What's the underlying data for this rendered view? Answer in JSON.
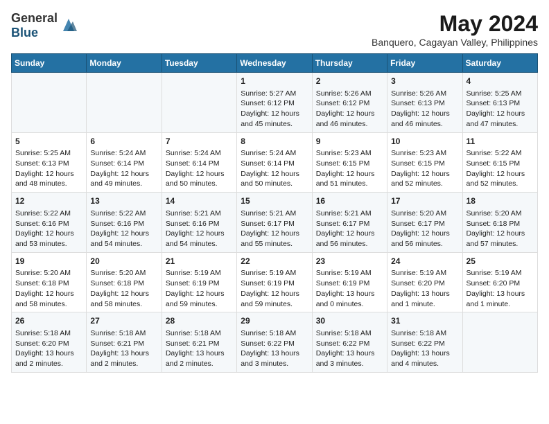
{
  "header": {
    "logo_general": "General",
    "logo_blue": "Blue",
    "month_title": "May 2024",
    "location": "Banquero, Cagayan Valley, Philippines"
  },
  "weekdays": [
    "Sunday",
    "Monday",
    "Tuesday",
    "Wednesday",
    "Thursday",
    "Friday",
    "Saturday"
  ],
  "weeks": [
    [
      {
        "day": "",
        "info": ""
      },
      {
        "day": "",
        "info": ""
      },
      {
        "day": "",
        "info": ""
      },
      {
        "day": "1",
        "info": "Sunrise: 5:27 AM\nSunset: 6:12 PM\nDaylight: 12 hours and 45 minutes."
      },
      {
        "day": "2",
        "info": "Sunrise: 5:26 AM\nSunset: 6:12 PM\nDaylight: 12 hours and 46 minutes."
      },
      {
        "day": "3",
        "info": "Sunrise: 5:26 AM\nSunset: 6:13 PM\nDaylight: 12 hours and 46 minutes."
      },
      {
        "day": "4",
        "info": "Sunrise: 5:25 AM\nSunset: 6:13 PM\nDaylight: 12 hours and 47 minutes."
      }
    ],
    [
      {
        "day": "5",
        "info": "Sunrise: 5:25 AM\nSunset: 6:13 PM\nDaylight: 12 hours and 48 minutes."
      },
      {
        "day": "6",
        "info": "Sunrise: 5:24 AM\nSunset: 6:14 PM\nDaylight: 12 hours and 49 minutes."
      },
      {
        "day": "7",
        "info": "Sunrise: 5:24 AM\nSunset: 6:14 PM\nDaylight: 12 hours and 50 minutes."
      },
      {
        "day": "8",
        "info": "Sunrise: 5:24 AM\nSunset: 6:14 PM\nDaylight: 12 hours and 50 minutes."
      },
      {
        "day": "9",
        "info": "Sunrise: 5:23 AM\nSunset: 6:15 PM\nDaylight: 12 hours and 51 minutes."
      },
      {
        "day": "10",
        "info": "Sunrise: 5:23 AM\nSunset: 6:15 PM\nDaylight: 12 hours and 52 minutes."
      },
      {
        "day": "11",
        "info": "Sunrise: 5:22 AM\nSunset: 6:15 PM\nDaylight: 12 hours and 52 minutes."
      }
    ],
    [
      {
        "day": "12",
        "info": "Sunrise: 5:22 AM\nSunset: 6:16 PM\nDaylight: 12 hours and 53 minutes."
      },
      {
        "day": "13",
        "info": "Sunrise: 5:22 AM\nSunset: 6:16 PM\nDaylight: 12 hours and 54 minutes."
      },
      {
        "day": "14",
        "info": "Sunrise: 5:21 AM\nSunset: 6:16 PM\nDaylight: 12 hours and 54 minutes."
      },
      {
        "day": "15",
        "info": "Sunrise: 5:21 AM\nSunset: 6:17 PM\nDaylight: 12 hours and 55 minutes."
      },
      {
        "day": "16",
        "info": "Sunrise: 5:21 AM\nSunset: 6:17 PM\nDaylight: 12 hours and 56 minutes."
      },
      {
        "day": "17",
        "info": "Sunrise: 5:20 AM\nSunset: 6:17 PM\nDaylight: 12 hours and 56 minutes."
      },
      {
        "day": "18",
        "info": "Sunrise: 5:20 AM\nSunset: 6:18 PM\nDaylight: 12 hours and 57 minutes."
      }
    ],
    [
      {
        "day": "19",
        "info": "Sunrise: 5:20 AM\nSunset: 6:18 PM\nDaylight: 12 hours and 58 minutes."
      },
      {
        "day": "20",
        "info": "Sunrise: 5:20 AM\nSunset: 6:18 PM\nDaylight: 12 hours and 58 minutes."
      },
      {
        "day": "21",
        "info": "Sunrise: 5:19 AM\nSunset: 6:19 PM\nDaylight: 12 hours and 59 minutes."
      },
      {
        "day": "22",
        "info": "Sunrise: 5:19 AM\nSunset: 6:19 PM\nDaylight: 12 hours and 59 minutes."
      },
      {
        "day": "23",
        "info": "Sunrise: 5:19 AM\nSunset: 6:19 PM\nDaylight: 13 hours and 0 minutes."
      },
      {
        "day": "24",
        "info": "Sunrise: 5:19 AM\nSunset: 6:20 PM\nDaylight: 13 hours and 1 minute."
      },
      {
        "day": "25",
        "info": "Sunrise: 5:19 AM\nSunset: 6:20 PM\nDaylight: 13 hours and 1 minute."
      }
    ],
    [
      {
        "day": "26",
        "info": "Sunrise: 5:18 AM\nSunset: 6:20 PM\nDaylight: 13 hours and 2 minutes."
      },
      {
        "day": "27",
        "info": "Sunrise: 5:18 AM\nSunset: 6:21 PM\nDaylight: 13 hours and 2 minutes."
      },
      {
        "day": "28",
        "info": "Sunrise: 5:18 AM\nSunset: 6:21 PM\nDaylight: 13 hours and 2 minutes."
      },
      {
        "day": "29",
        "info": "Sunrise: 5:18 AM\nSunset: 6:22 PM\nDaylight: 13 hours and 3 minutes."
      },
      {
        "day": "30",
        "info": "Sunrise: 5:18 AM\nSunset: 6:22 PM\nDaylight: 13 hours and 3 minutes."
      },
      {
        "day": "31",
        "info": "Sunrise: 5:18 AM\nSunset: 6:22 PM\nDaylight: 13 hours and 4 minutes."
      },
      {
        "day": "",
        "info": ""
      }
    ]
  ]
}
